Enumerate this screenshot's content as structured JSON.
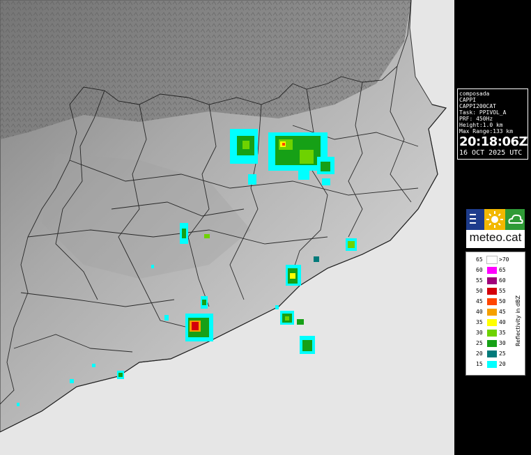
{
  "radar_info": {
    "lines": [
      "composada",
      "CAPPI",
      "CAPPI200CAT",
      "Task: PPIVOL_A",
      "PRF: 450Hz",
      "Height:1.0 km",
      "Max Range:133 km"
    ],
    "time": "20:18:06Z",
    "date": "16 OCT 2025 UTC"
  },
  "logo": {
    "text": "meteo.cat",
    "colors": [
      "#1e3c8c",
      "#f2b800",
      "#2f9a36"
    ],
    "icons": [
      "lines-icon",
      "sun-icon",
      "cloud-icon"
    ]
  },
  "legend": {
    "title": "Reflectivity in dBZ",
    "rows": [
      {
        "low": "65",
        "high": ">70",
        "color": "#ffffff"
      },
      {
        "low": "60",
        "high": "65",
        "color": "#ff00ff"
      },
      {
        "low": "55",
        "high": "60",
        "color": "#a0007a"
      },
      {
        "low": "50",
        "high": "55",
        "color": "#d4000a"
      },
      {
        "low": "45",
        "high": "50",
        "color": "#ff4500"
      },
      {
        "low": "40",
        "high": "45",
        "color": "#f5a000"
      },
      {
        "low": "35",
        "high": "40",
        "color": "#ffff00"
      },
      {
        "low": "30",
        "high": "35",
        "color": "#6ed200"
      },
      {
        "low": "25",
        "high": "30",
        "color": "#16a016"
      },
      {
        "low": "20",
        "high": "25",
        "color": "#007a7a"
      },
      {
        "low": "15",
        "high": "20",
        "color": "#00ffff"
      }
    ]
  },
  "colors": {
    "sea": "#e6e6e6",
    "background": "#000000",
    "border": "#000000"
  }
}
